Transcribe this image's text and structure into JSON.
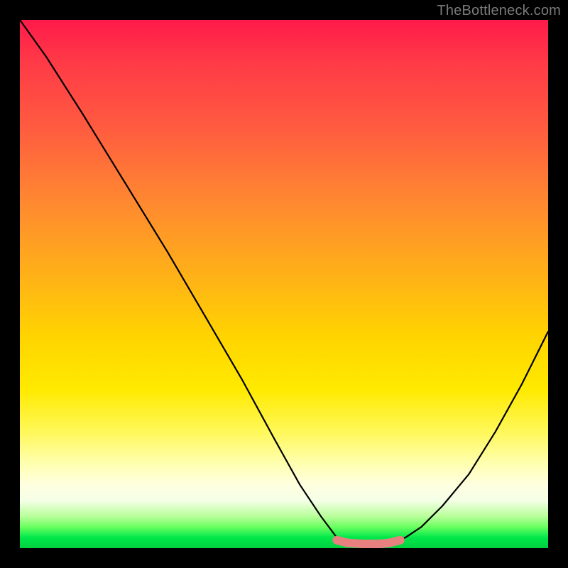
{
  "watermark": "TheBottleneck.com",
  "chart_data": {
    "type": "line",
    "title": "",
    "xlabel": "",
    "ylabel": "",
    "xlim": [
      0,
      100
    ],
    "ylim": [
      0,
      100
    ],
    "series": [
      {
        "name": "black-curve",
        "color": "#000000",
        "x": [
          0,
          5,
          12,
          20,
          28,
          35,
          42,
          48,
          53,
          57,
          60,
          62,
          65,
          70,
          73,
          76,
          80,
          85,
          90,
          95,
          100
        ],
        "values": [
          100,
          93,
          82,
          69,
          56,
          44,
          32,
          21,
          12,
          6,
          2,
          1,
          1,
          1,
          2,
          4,
          8,
          14,
          22,
          31,
          41
        ]
      },
      {
        "name": "pink-floor-segment",
        "color": "#e88080",
        "x": [
          60,
          62,
          65,
          68,
          70,
          72
        ],
        "values": [
          1.5,
          1.0,
          0.8,
          0.8,
          1.0,
          1.5
        ]
      }
    ],
    "legend": false,
    "grid": false
  }
}
